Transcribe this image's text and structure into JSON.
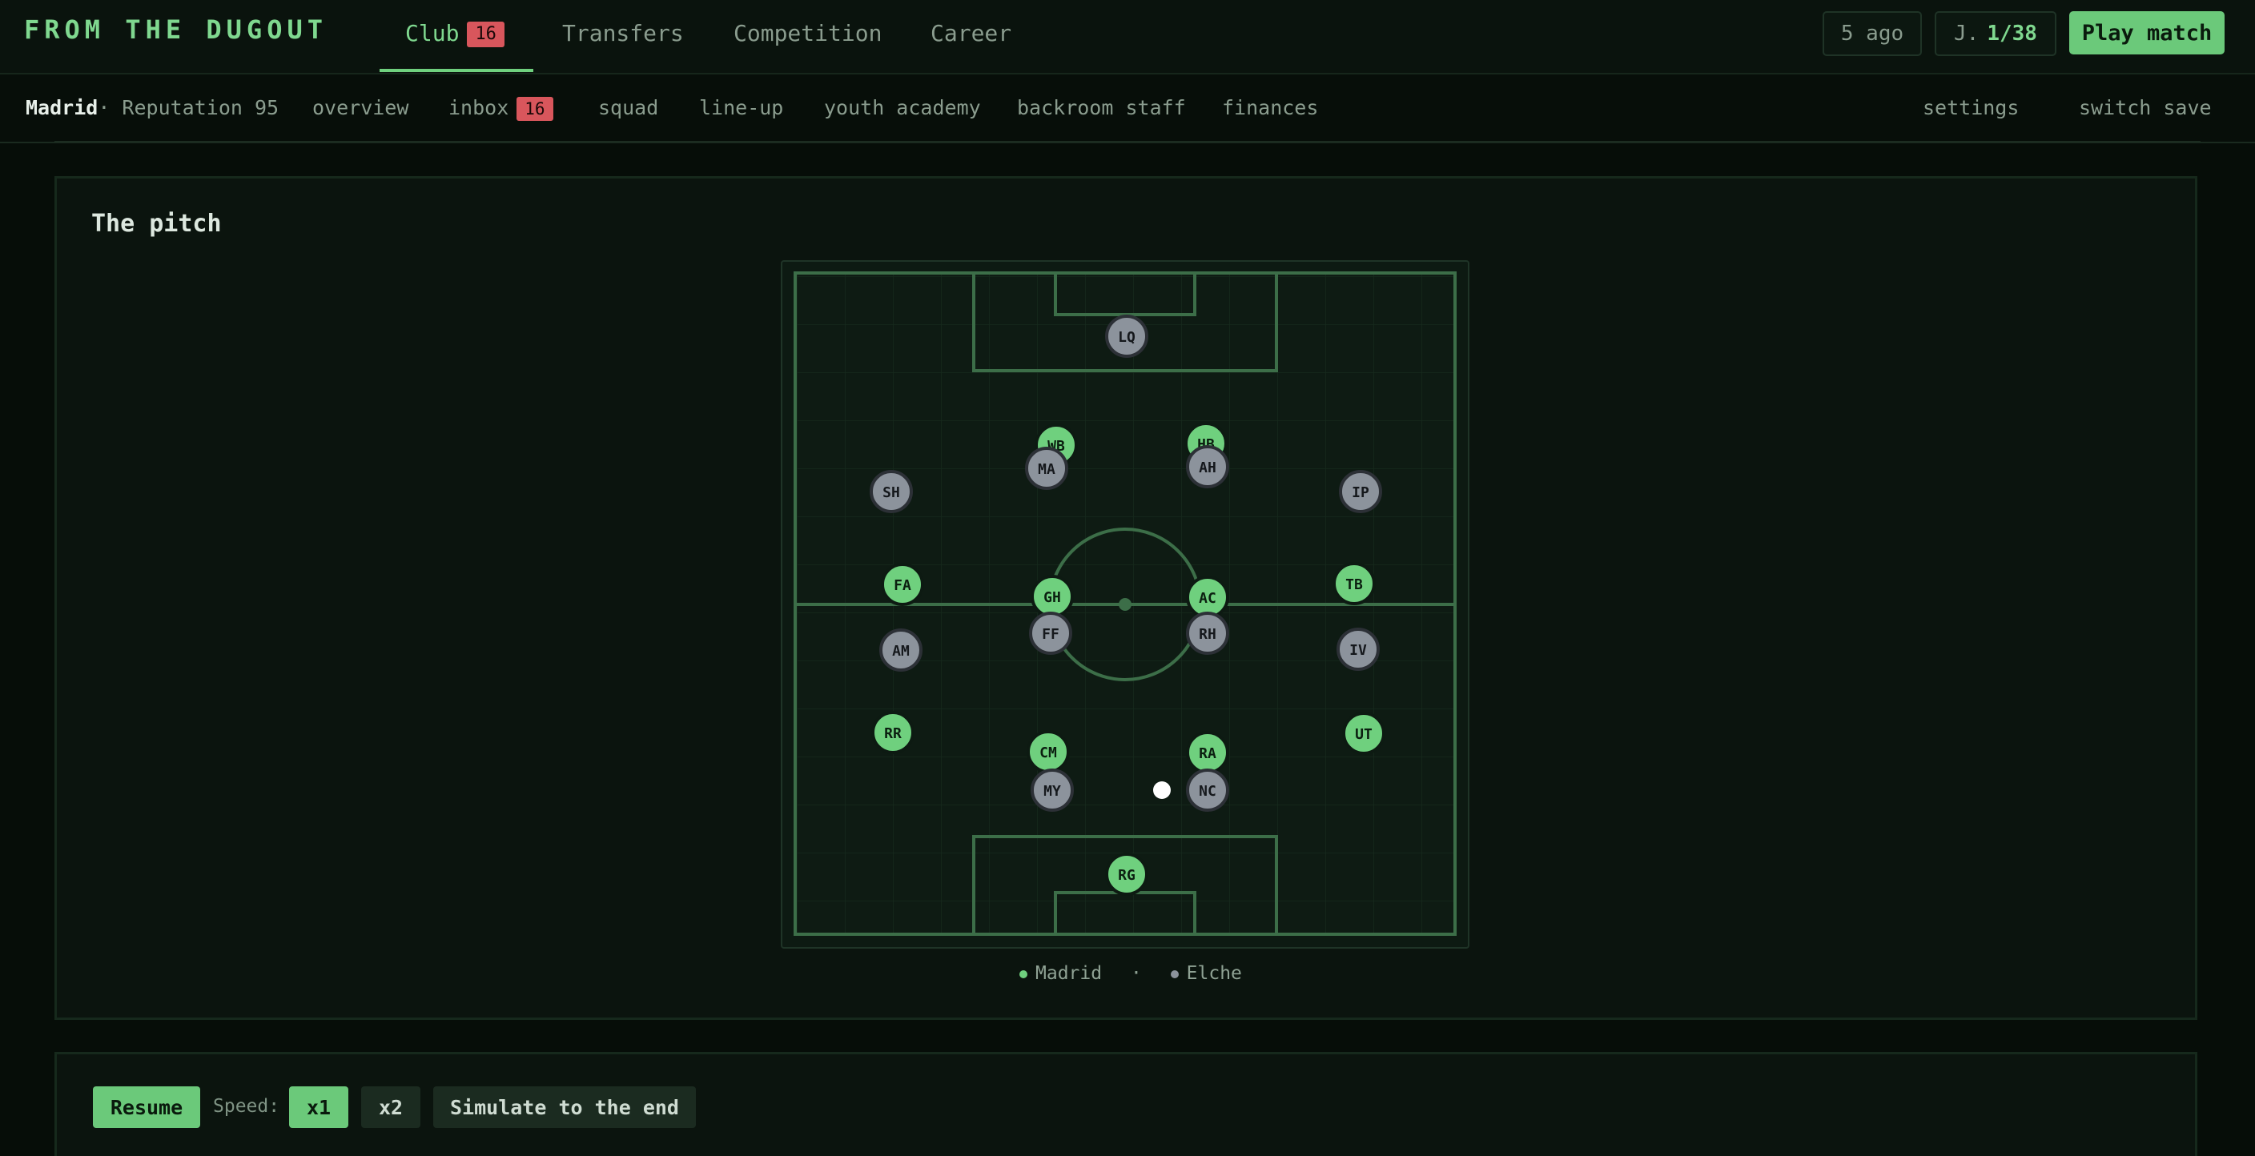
{
  "app": {
    "title": "FROM THE DUGOUT"
  },
  "top_tabs": [
    {
      "label": "Club",
      "badge": "16",
      "active": true
    },
    {
      "label": "Transfers"
    },
    {
      "label": "Competition"
    },
    {
      "label": "Career"
    }
  ],
  "top_right": {
    "saved_label": "5 ago",
    "matchday_prefix": "J.",
    "matchday_value": "1/38",
    "play_label": "Play match"
  },
  "subnav": {
    "club_name": "Madrid",
    "reputation": "· Reputation 95",
    "items": [
      "overview",
      "inbox",
      "squad",
      "line-up",
      "youth academy",
      "backroom staff",
      "finances"
    ],
    "inbox_badge": "16",
    "settings": "settings",
    "switch_save": "switch save"
  },
  "pitch_panel": {
    "title": "The pitch",
    "legend": {
      "home": "Madrid",
      "separator": "·",
      "away": "Elche"
    }
  },
  "players": {
    "home": [
      {
        "initials": "RG"
      },
      {
        "initials": "RR"
      },
      {
        "initials": "CM"
      },
      {
        "initials": "RA"
      },
      {
        "initials": "UT"
      },
      {
        "initials": "FA"
      },
      {
        "initials": "GH"
      },
      {
        "initials": "AC"
      },
      {
        "initials": "TB"
      },
      {
        "initials": "WB"
      },
      {
        "initials": "HB"
      }
    ],
    "away": [
      {
        "initials": "LQ"
      },
      {
        "initials": "SH"
      },
      {
        "initials": "MA"
      },
      {
        "initials": "AH"
      },
      {
        "initials": "IP"
      },
      {
        "initials": "AM"
      },
      {
        "initials": "FF"
      },
      {
        "initials": "RH"
      },
      {
        "initials": "IV"
      },
      {
        "initials": "MY"
      },
      {
        "initials": "NC"
      }
    ]
  },
  "controls": {
    "resume": "Resume",
    "speed_label": "Speed:",
    "x1": "x1",
    "x2": "x2",
    "simulate": "Simulate to the end"
  },
  "colors": {
    "accent": "#6bc97a",
    "badge": "#d8565c",
    "home_token": "#6fd07e",
    "away_token": "#8c939c"
  }
}
